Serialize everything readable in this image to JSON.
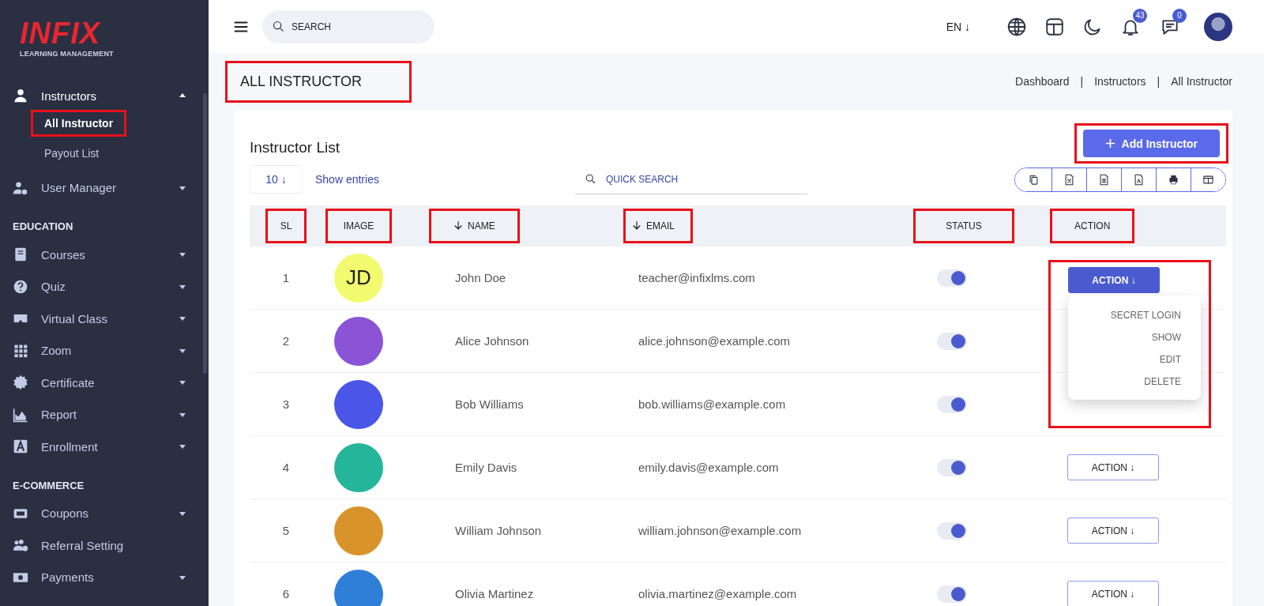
{
  "sidebar": {
    "logo": {
      "title": "INFIX",
      "subtitle": "LEARNING MANAGEMENT"
    },
    "groups": [
      {
        "items": [
          {
            "label": "Instructors",
            "expanded": true,
            "children": [
              {
                "label": "All Instructor",
                "selected": true,
                "highlighted": true
              },
              {
                "label": "Payout List",
                "selected": false,
                "highlighted": false
              }
            ]
          },
          {
            "label": "User Manager",
            "expanded": false
          }
        ]
      },
      {
        "heading": "EDUCATION",
        "items": [
          {
            "label": "Courses",
            "expanded": false
          },
          {
            "label": "Quiz",
            "expanded": false
          },
          {
            "label": "Virtual Class",
            "expanded": false
          },
          {
            "label": "Zoom",
            "expanded": false
          },
          {
            "label": "Certificate",
            "expanded": false
          },
          {
            "label": "Report",
            "expanded": false
          },
          {
            "label": "Enrollment",
            "expanded": false
          }
        ]
      },
      {
        "heading": "E-COMMERCE",
        "items": [
          {
            "label": "Coupons",
            "expanded": false
          },
          {
            "label": "Referral Setting"
          },
          {
            "label": "Payments",
            "expanded": false
          }
        ]
      }
    ]
  },
  "topbar": {
    "search": {
      "placeholder": "SEARCH"
    },
    "language": "EN ↓",
    "notifications": "43",
    "messages": "0"
  },
  "page": {
    "title": "ALL INSTRUCTOR",
    "title_highlighted": true,
    "breadcrumb": {
      "separator": "|",
      "items": [
        "Dashboard",
        "Instructors",
        "All Instructor"
      ]
    }
  },
  "card": {
    "title": "Instructor List",
    "add_button": {
      "label": "Add Instructor",
      "highlighted": true
    },
    "entries": {
      "value": "10 ↓",
      "label": "Show entries"
    },
    "quick_search": {
      "placeholder": "QUICK SEARCH"
    },
    "table": {
      "columns": [
        {
          "label": "SL",
          "sortable": false,
          "highlighted": true
        },
        {
          "label": "IMAGE",
          "sortable": false,
          "highlighted": true
        },
        {
          "label": "NAME",
          "sortable": true,
          "highlighted": true
        },
        {
          "label": "EMAIL",
          "sortable": true,
          "highlighted": true
        },
        {
          "label": "STATUS",
          "sortable": false,
          "highlighted": true
        },
        {
          "label": "ACTION",
          "sortable": false,
          "highlighted": true
        }
      ],
      "rows": [
        {
          "sl": "1",
          "image": {
            "kind": "initials",
            "text": "JD"
          },
          "name": "John Doe",
          "email": "teacher@infixlms.com",
          "on": true,
          "action": {
            "label": "ACTION ↓",
            "open": true,
            "highlighted": true,
            "menu": [
              "SECRET LOGIN",
              "SHOW",
              "EDIT",
              "DELETE"
            ]
          }
        },
        {
          "sl": "2",
          "image": {
            "kind": "photo"
          },
          "name": "Alice Johnson",
          "email": "alice.johnson@example.com",
          "on": true
        },
        {
          "sl": "3",
          "image": {
            "kind": "photo"
          },
          "name": "Bob Williams",
          "email": "bob.williams@example.com",
          "on": true
        },
        {
          "sl": "4",
          "image": {
            "kind": "photo"
          },
          "name": "Emily Davis",
          "email": "emily.davis@example.com",
          "on": true,
          "action": {
            "label": "ACTION ↓",
            "open": false,
            "highlighted": false
          }
        },
        {
          "sl": "5",
          "image": {
            "kind": "photo"
          },
          "name": "William Johnson",
          "email": "william.johnson@example.com",
          "on": true,
          "action": {
            "label": "ACTION ↓",
            "open": false,
            "highlighted": false
          }
        },
        {
          "sl": "6",
          "image": {
            "kind": "photo"
          },
          "name": "Olivia Martinez",
          "email": "olivia.martinez@example.com",
          "on": true,
          "action": {
            "label": "ACTION ↓",
            "open": false,
            "highlighted": false
          }
        }
      ]
    }
  }
}
